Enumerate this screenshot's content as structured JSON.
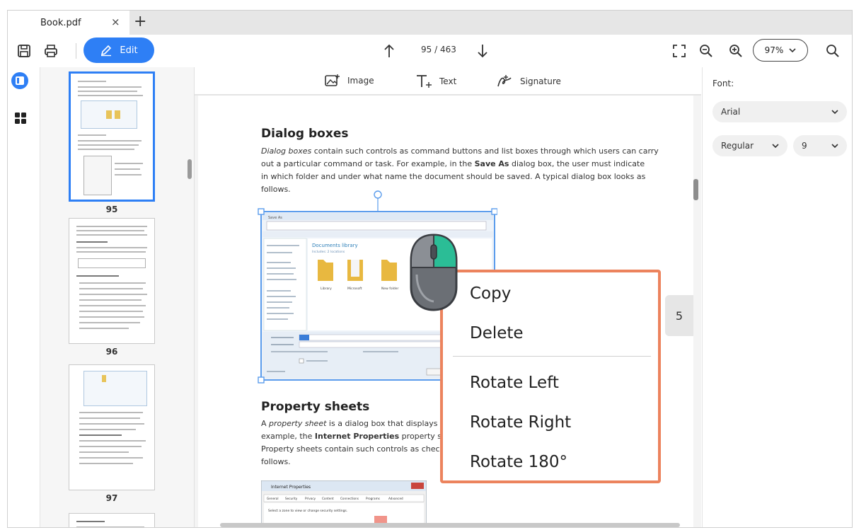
{
  "tab": {
    "title": "Book.pdf",
    "close": "×",
    "add": "+"
  },
  "toolbar": {
    "edit_label": "Edit",
    "page_indicator": "95 / 463",
    "zoom_value": "97%"
  },
  "insert_bar": {
    "image_label": "Image",
    "text_label": "Text",
    "signature_label": "Signature"
  },
  "thumbnails": [
    {
      "page": "95",
      "selected": true
    },
    {
      "page": "96",
      "selected": false
    },
    {
      "page": "97",
      "selected": false
    }
  ],
  "document": {
    "heading1": "Dialog boxes",
    "para1_italic": "Dialog boxes",
    "para1_a": " contain such controls as command buttons and list boxes through which users can carry",
    "para1_b": "out a particular command or task. For example, in the ",
    "para1_bold": "Save As",
    "para1_c": " dialog box, the user must indicate",
    "para1_d": "in which folder and under what name the document should be saved. A typical dialog box looks as",
    "para1_e": "follows.",
    "heading2": "Property sheets",
    "para2_a": "A ",
    "para2_italic": "property sheet",
    "para2_b": " is a dialog box that displays in",
    "para2_c": "example, the ",
    "para2_bold": "Internet Properties",
    "para2_d": " property sh",
    "para2_e": "Property sheets contain such controls as check",
    "para2_f": "follows.",
    "embedded_title": "Internet Properties",
    "embedded_tabs": [
      "General",
      "Security",
      "Privacy",
      "Content",
      "Connections",
      "Programs",
      "Advanced"
    ],
    "embedded_hint": "Select a zone to view or change security settings.",
    "dialog_library_title": "Documents library",
    "dialog_library_sub": "Includes: 2 locations",
    "dialog_folders": [
      "Library",
      "Microsoft",
      "New folder"
    ]
  },
  "page_tab": {
    "number": "5"
  },
  "context_menu": {
    "items": [
      "Copy",
      "Delete",
      "Rotate Left",
      "Rotate Right",
      "Rotate 180°"
    ]
  },
  "right_panel": {
    "font_label": "Font:",
    "font_family": "Arial",
    "font_style": "Regular",
    "font_size": "9"
  },
  "colors": {
    "accent": "#2e7ff5",
    "menu_border": "#ec835d",
    "mouse_highlight": "#2bbd96"
  }
}
